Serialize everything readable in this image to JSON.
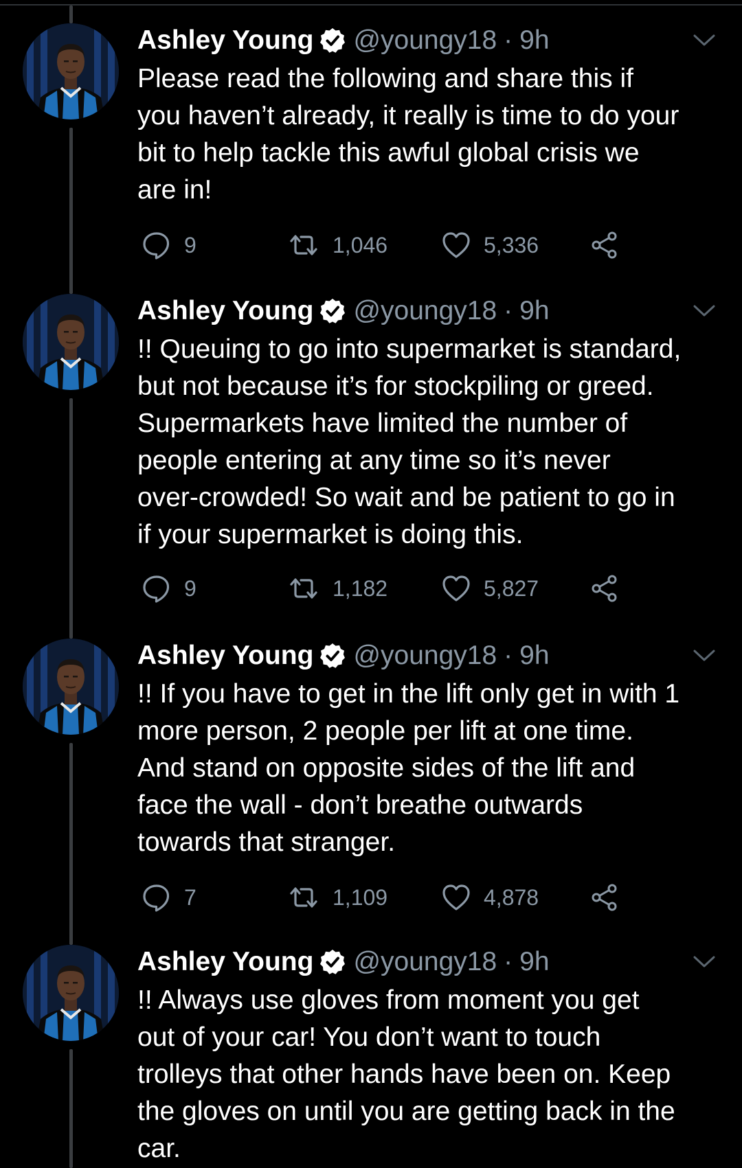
{
  "tweets": [
    {
      "name": "Ashley Young",
      "handle": "@youngy18",
      "separator": "·",
      "time": "9h",
      "text": "Please read the following and share this if\nyou haven’t already, it really is time to do your\nbit to help tackle this awful global crisis we\nare in!",
      "replies": "9",
      "retweets": "1,046",
      "likes": "5,336"
    },
    {
      "name": "Ashley Young",
      "handle": "@youngy18",
      "separator": "·",
      "time": "9h",
      "text": "!! Queuing to go into supermarket is standard,\nbut not because it’s for stockpiling or greed.\nSupermarkets have limited the number of\npeople entering at any time so it’s never\nover-crowded! So wait and be patient to go in\nif your supermarket is doing this.",
      "replies": "9",
      "retweets": "1,182",
      "likes": "5,827"
    },
    {
      "name": "Ashley Young",
      "handle": "@youngy18",
      "separator": "·",
      "time": "9h",
      "text": "!! If you have to get in the lift only get in with 1\nmore person, 2 people per lift at one time.\nAnd stand on opposite sides of the lift and\nface the wall - don’t breathe outwards\ntowards that stranger.",
      "replies": "7",
      "retweets": "1,109",
      "likes": "4,878"
    },
    {
      "name": "Ashley Young",
      "handle": "@youngy18",
      "separator": "·",
      "time": "9h",
      "text": "!! Always use gloves from moment you get\nout of your car! You don’t want to touch\ntrolleys that other hands have been on. Keep\nthe gloves on until you are getting back in the\ncar."
    }
  ],
  "icons": {
    "verified": "verified-badge-icon",
    "more": "chevron-down-icon",
    "reply": "reply-bubble-icon",
    "retweet": "retweet-icon",
    "like": "heart-icon",
    "share": "share-icon"
  },
  "colors": {
    "background": "#000000",
    "primary_text": "#ffffff",
    "secondary_text": "#8b98a5",
    "thread_line": "#3a3d40",
    "verified_badge": "#ffffff",
    "jersey_blue": "#1f6fb8",
    "jersey_black": "#0a0a0a"
  }
}
